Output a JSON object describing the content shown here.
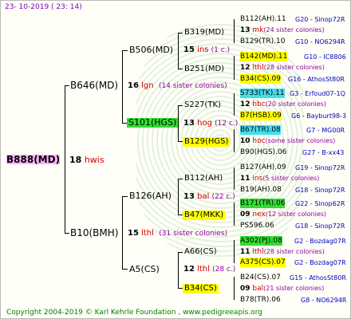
{
  "header": {
    "date": "23- 10-2019 ( 23: 14)"
  },
  "footer": {
    "copyright": "Copyright 2004-2019 © Karl Kehrle Foundation",
    "site": "www.pedigreeapis.org"
  },
  "root": {
    "name": "B888(MD)",
    "num": "18",
    "tag": "hwis"
  },
  "gen2": [
    {
      "name": "B646(MD)",
      "num": "16",
      "tag": "lgn",
      "extra": "(14 sister colonies)"
    },
    {
      "name": "B10(BMH)",
      "num": "15",
      "tag": "lthl",
      "extra": "(31 sister colonies)"
    }
  ],
  "gen3": [
    {
      "name": "B506(MD)",
      "num": "15",
      "tag": "ins",
      "extra": "(1 c.)"
    },
    {
      "name": "S101(HGS)",
      "num": "13",
      "tag": "hog",
      "extra": "(12 c.)"
    },
    {
      "name": "B126(AH)",
      "num": "13",
      "tag": "bal",
      "extra": "(22 c.)"
    },
    {
      "name": "A5(CS)",
      "num": "12",
      "tag": "lthl",
      "extra": "(28 c.)"
    }
  ],
  "gen4": [
    "B319(MD)",
    "B251(MD)",
    "S227(TK)",
    "B129(HGS)",
    "B112(AH)",
    "B47(MKK)",
    "A66(CS)",
    "B34(CS)"
  ],
  "gen5": [
    {
      "top": "B112(AH).11",
      "topref": "G20 - Sinop72R",
      "num": "13",
      "tag": "mk",
      "sis": "(24 sister colonies)",
      "bot": "B129(TR).10",
      "botref": "G10 - NO6294R"
    },
    {
      "top": "B142(MD).11",
      "topref": "G10 - IC8806",
      "num": "12",
      "tag": "lthl",
      "sis": "(28 sister colonies)",
      "bot": "B34(CS).09",
      "botref": "G16 - AthosSt80R"
    },
    {
      "top": "S733(TK).11",
      "topref": "G3 - Erfoud07-1Q",
      "num": "12",
      "tag": "hbc",
      "sis": "(20 sister colonies)",
      "bot": "B7(HSB).09",
      "botref": "G6 - Bayburt98-3"
    },
    {
      "top": "B67(TR).08",
      "topref": "G7 - MG00R",
      "num": "10",
      "tag": "hoc",
      "sis": "(some sister colonies)",
      "bot": "B90(HGS).06",
      "botref": "G27 - B-xx43"
    },
    {
      "top": "B127(AH).09",
      "topref": "G19 - Sinop72R",
      "num": "11",
      "tag": "ins",
      "sis": "(5 sister colonies)",
      "bot": "B19(AH).08",
      "botref": "G18 - Sinop72R"
    },
    {
      "top": "B171(TR).06",
      "topref": "G22 - Sinop62R",
      "num": "09",
      "tag": "nex",
      "sis": "(12 sister colonies)",
      "bot": "PS596.06",
      "botref": "G18 - Sinop72R"
    },
    {
      "top": "A302(PJ).08",
      "topref": "G2 - Bozdag07R",
      "num": "11",
      "tag": "lthl",
      "sis": "(28 sister colonies)",
      "bot": "A375(CS).07",
      "botref": "G2 - Bozdag07R"
    },
    {
      "top": "B24(CS).07",
      "topref": "G15 - AthosSt80R",
      "num": "09",
      "tag": "bal",
      "sis": "(21 sister colonies)",
      "bot": "B78(TR).06",
      "botref": "G8 - NO6294R"
    }
  ],
  "colors": {
    "hdr": "#8000c0",
    "footer": "#008000",
    "red": "#d00000",
    "blue": "#0000c0",
    "yellow": "#ffff00",
    "green": "#33dd33",
    "cyan": "#44ddee",
    "root": "#ffb0ff"
  }
}
